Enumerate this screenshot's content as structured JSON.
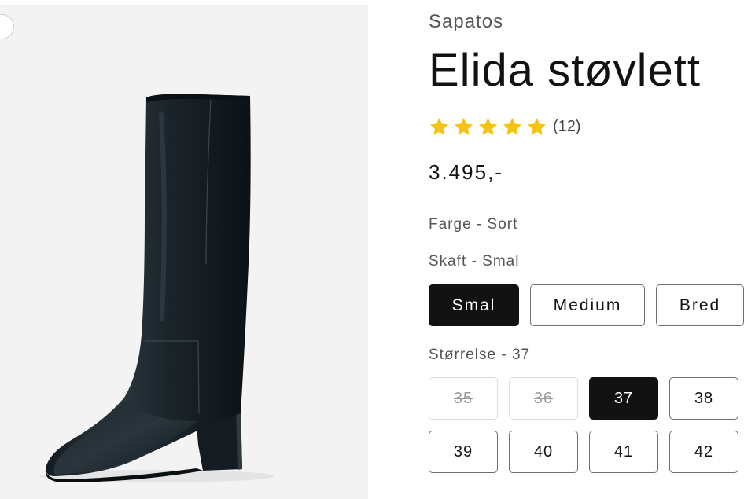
{
  "product": {
    "vendor": "Sapatos",
    "title": "Elida støvlett",
    "rating": {
      "stars": 5,
      "max_stars": 5,
      "count_text": "(12)",
      "star_color": "#F4C414"
    },
    "price": "3.495,-",
    "image": {
      "icon": "black-knee-high-leather-boot-image",
      "background": "#F3F3F3"
    }
  },
  "options": {
    "color_label": "Farge - Sort",
    "shaft_label": "Skaft - Smal",
    "shaft_values": [
      "Smal",
      "Medium",
      "Bred"
    ],
    "shaft_selected": "Smal",
    "size_label": "Størrelse - 37",
    "size_values": [
      "35",
      "36",
      "37",
      "38",
      "39",
      "40",
      "41",
      "42"
    ],
    "size_selected": "37",
    "size_unavailable": [
      "35",
      "36"
    ]
  },
  "colors": {
    "selected_bg": "#121212",
    "selected_text": "#FFFFFF",
    "border": "#6F6F6F",
    "unavailable_border": "#DDDDDD"
  }
}
